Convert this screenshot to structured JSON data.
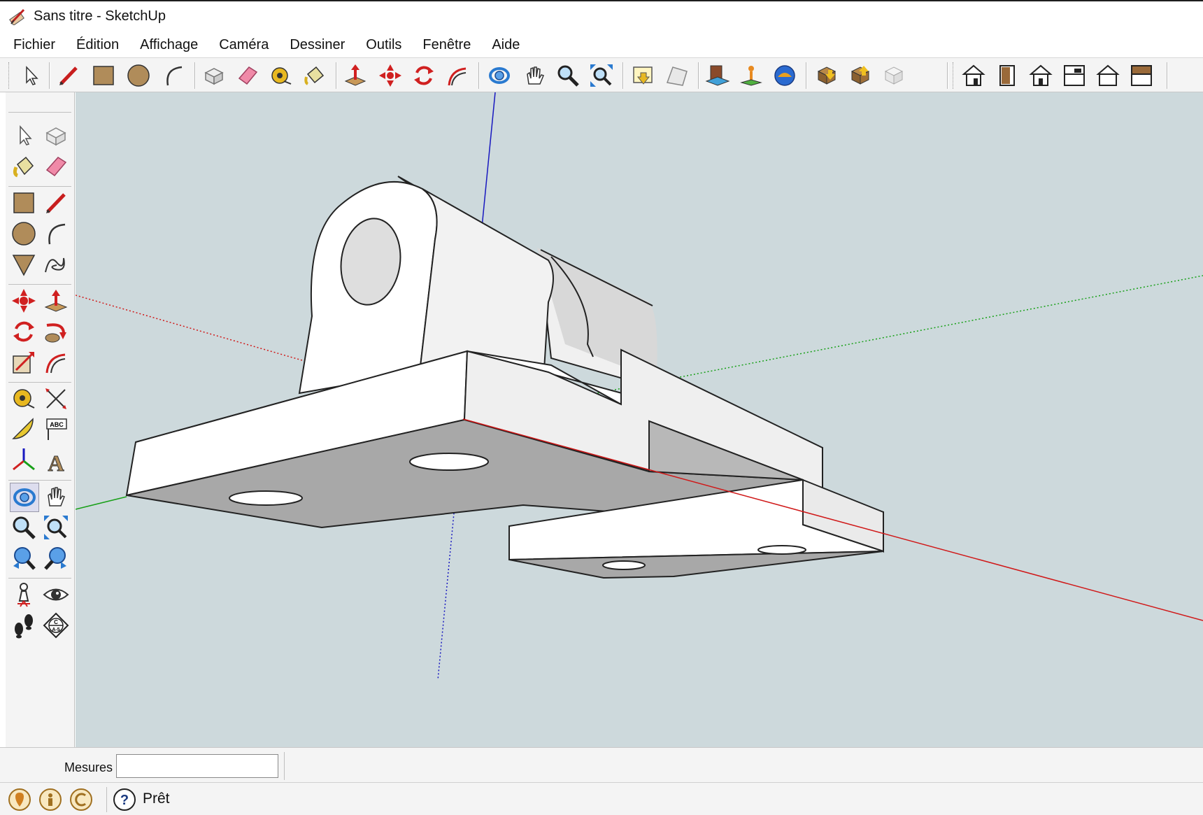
{
  "window": {
    "title": "Sans titre - SketchUp"
  },
  "menu": [
    "Fichier",
    "Édition",
    "Affichage",
    "Caméra",
    "Dessiner",
    "Outils",
    "Fenêtre",
    "Aide"
  ],
  "toolbar": {
    "icons": [
      "select-icon",
      "pencil-icon",
      "rectangle-icon",
      "circle-icon",
      "arc-icon",
      "make-component-icon",
      "eraser-icon",
      "tape-measure-icon",
      "paint-bucket-icon",
      "push-pull-icon",
      "move-icon",
      "rotate-icon",
      "follow-me-icon",
      "orbit-icon",
      "pan-icon",
      "zoom-icon",
      "zoom-extents-icon",
      "add-location-icon",
      "toggle-terrain-icon",
      "photo-textures-icon",
      "get-models-icon",
      "share-model-icon",
      "3d-warehouse-icon",
      "extension-warehouse-icon",
      "share-component-icon",
      "iso-view-icon",
      "top-view-icon",
      "front-view-icon",
      "right-view-icon",
      "back-view-icon",
      "left-view-icon"
    ]
  },
  "status": {
    "measures_label": "Mesures",
    "measures_value": "",
    "ready_text": "Prêt"
  },
  "colors": {
    "viewport_bg": "#cdd9dc",
    "red_axis": "#d01818",
    "green_axis": "#18a018",
    "blue_axis": "#1818c0"
  }
}
